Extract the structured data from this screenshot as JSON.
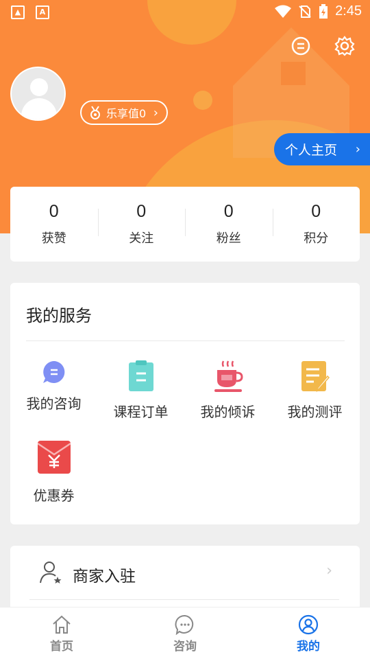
{
  "status_bar": {
    "time": "2:45"
  },
  "profile": {
    "points_label": "乐享值0",
    "homepage_label": "个人主页"
  },
  "stats": [
    {
      "value": "0",
      "label": "获赞"
    },
    {
      "value": "0",
      "label": "关注"
    },
    {
      "value": "0",
      "label": "粉丝"
    },
    {
      "value": "0",
      "label": "积分"
    }
  ],
  "services": {
    "title": "我的服务",
    "items": [
      {
        "label": "我的咨询",
        "icon": "chat-bubble-icon"
      },
      {
        "label": "课程订单",
        "icon": "clipboard-icon"
      },
      {
        "label": "我的倾诉",
        "icon": "coffee-cup-icon"
      },
      {
        "label": "我的测评",
        "icon": "notepad-icon"
      },
      {
        "label": "优惠券",
        "icon": "red-envelope-icon"
      }
    ]
  },
  "merchant": {
    "label": "商家入驻"
  },
  "bottom_nav": [
    {
      "label": "首页",
      "icon": "home-icon",
      "active": false
    },
    {
      "label": "咨询",
      "icon": "chat-icon",
      "active": false
    },
    {
      "label": "我的",
      "icon": "user-icon",
      "active": true
    }
  ],
  "colors": {
    "header": "#fb8a3b",
    "accent": "#1a73e8"
  }
}
